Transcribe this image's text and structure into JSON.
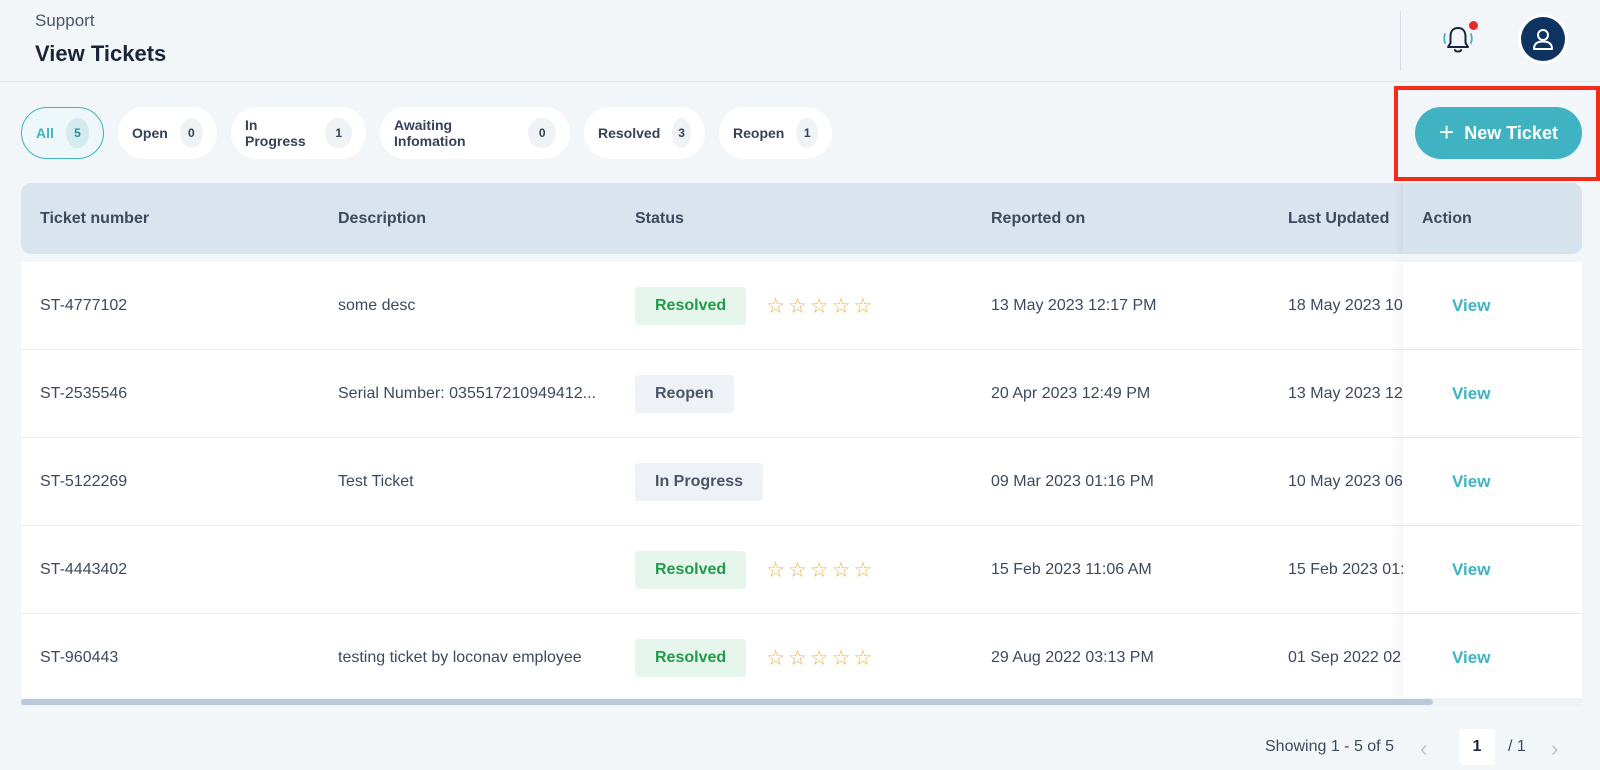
{
  "header": {
    "breadcrumb": "Support",
    "title": "View Tickets",
    "notification_icon": "bell-icon",
    "notification_dot_color": "#e42b2b",
    "avatar_icon": "user-icon"
  },
  "filters": [
    {
      "label": "All",
      "count": "5",
      "active": true
    },
    {
      "label": "Open",
      "count": "0",
      "active": false
    },
    {
      "label": "In Progress",
      "count": "1",
      "active": false
    },
    {
      "label": "Awaiting Infomation",
      "count": "0",
      "active": false
    },
    {
      "label": "Resolved",
      "count": "3",
      "active": false
    },
    {
      "label": "Reopen",
      "count": "1",
      "active": false
    }
  ],
  "new_ticket": {
    "label": "New Ticket",
    "icon": "plus-icon"
  },
  "table": {
    "columns": [
      "Ticket number",
      "Description",
      "Status",
      "Reported on",
      "Last Updated",
      "Action"
    ],
    "rows": [
      {
        "ticket": "ST-4777102",
        "description": "some desc",
        "status": "Resolved",
        "rating": true,
        "reported": "13 May 2023 12:17 PM",
        "updated": "18 May 2023 10",
        "action": "View"
      },
      {
        "ticket": "ST-2535546",
        "description": "Serial Number: 035517210949412...",
        "status": "Reopen",
        "rating": false,
        "reported": "20 Apr 2023 12:49 PM",
        "updated": "13 May 2023 12:",
        "action": "View"
      },
      {
        "ticket": "ST-5122269",
        "description": "Test Ticket",
        "status": "In Progress",
        "rating": false,
        "reported": "09 Mar 2023 01:16 PM",
        "updated": "10 May 2023 06",
        "action": "View"
      },
      {
        "ticket": "ST-4443402",
        "description": "",
        "status": "Resolved",
        "rating": true,
        "reported": "15 Feb 2023 11:06 AM",
        "updated": "15 Feb 2023 01:",
        "action": "View"
      },
      {
        "ticket": "ST-960443",
        "description": "testing ticket by loconav employee",
        "status": "Resolved",
        "rating": true,
        "reported": "29 Aug 2022 03:13 PM",
        "updated": "01 Sep 2022 02",
        "action": "View"
      }
    ]
  },
  "pagination": {
    "showing": "Showing 1 - 5 of 5",
    "current_page": "1",
    "total": "/ 1",
    "prev_icon": "chevron-left-icon",
    "next_icon": "chevron-right-icon"
  },
  "colors": {
    "accent": "#3fb3c1",
    "resolved": "#1f9b49",
    "star": "#f0b43a",
    "highlight_frame": "#f32b1a"
  }
}
